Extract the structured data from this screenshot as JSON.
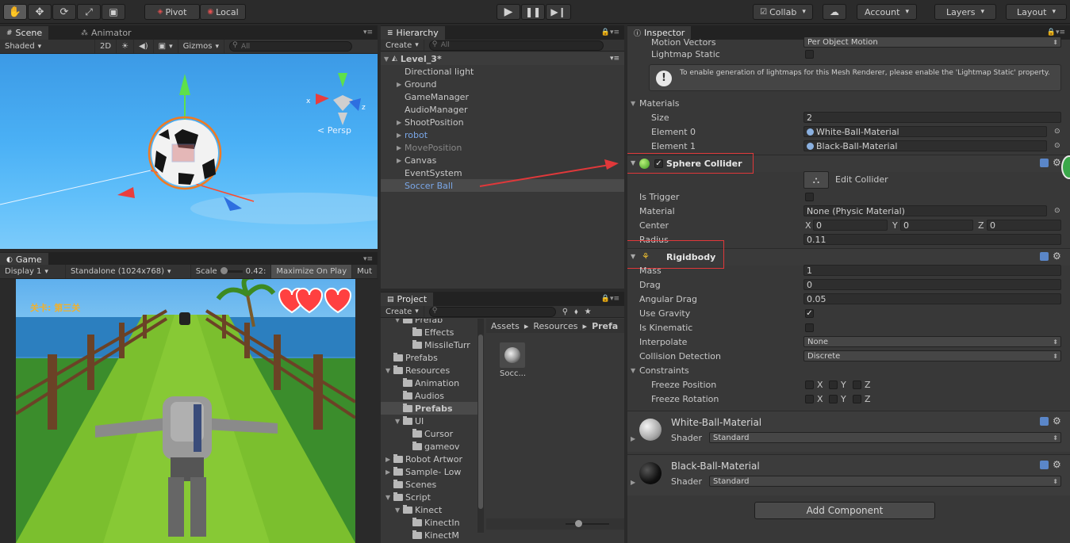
{
  "toolbar": {
    "tools": [
      "hand-tool-icon",
      "move-tool-icon",
      "rotate-tool-icon",
      "scale-tool-icon",
      "rect-tool-icon"
    ],
    "pivot_label": "Pivot",
    "local_label": "Local",
    "collab_label": "Collab",
    "account_label": "Account",
    "layers_label": "Layers",
    "layout_label": "Layout"
  },
  "scene": {
    "tab_label": "Scene",
    "animator_tab_label": "Animator",
    "shading_mode": "Shaded",
    "mode_2d": "2D",
    "gizmos_label": "Gizmos",
    "search_placeholder": "All",
    "persp_label": "< Persp",
    "axis_x": "x",
    "axis_z": "z"
  },
  "game": {
    "tab_label": "Game",
    "display": "Display 1",
    "resolution": "Standalone (1024x768)",
    "scale_label": "Scale",
    "scale_value": "0.42:",
    "maximize_label": "Maximize On Play",
    "mute_label": "Mut",
    "level_text": "关卡: 第三关"
  },
  "hierarchy": {
    "tab_label": "Hierarchy",
    "create_label": "Create",
    "search_placeholder": "All",
    "scene_name": "Level_3*",
    "items": [
      {
        "label": "Directional light",
        "arrow": "",
        "color": "#c8c8c8"
      },
      {
        "label": "Ground",
        "arrow": "▶",
        "color": "#c8c8c8"
      },
      {
        "label": "GameManager",
        "arrow": "",
        "color": "#c8c8c8"
      },
      {
        "label": "AudioManager",
        "arrow": "",
        "color": "#c8c8c8"
      },
      {
        "label": "ShootPosition",
        "arrow": "▶",
        "color": "#c8c8c8"
      },
      {
        "label": "robot",
        "arrow": "▶",
        "color": "#7aa7e8"
      },
      {
        "label": "MovePosition",
        "arrow": "▶",
        "color": "#888888"
      },
      {
        "label": "Canvas",
        "arrow": "▶",
        "color": "#c8c8c8"
      },
      {
        "label": "EventSystem",
        "arrow": "",
        "color": "#c8c8c8"
      },
      {
        "label": "Soccer Ball",
        "arrow": "",
        "color": "#7aa7e8"
      }
    ]
  },
  "project": {
    "tab_label": "Project",
    "create_label": "Create",
    "breadcrumb": [
      "Assets",
      "Resources",
      "Prefa"
    ],
    "asset_label": "Socc...",
    "tree": [
      {
        "label": "Prefab",
        "indent": 2,
        "arrow": "▼"
      },
      {
        "label": "Effects",
        "indent": 3,
        "arrow": ""
      },
      {
        "label": "MissileTurr",
        "indent": 3,
        "arrow": ""
      },
      {
        "label": "Prefabs",
        "indent": 1,
        "arrow": ""
      },
      {
        "label": "Resources",
        "indent": 1,
        "arrow": "▼"
      },
      {
        "label": "Animation",
        "indent": 2,
        "arrow": ""
      },
      {
        "label": "Audios",
        "indent": 2,
        "arrow": ""
      },
      {
        "label": "Prefabs",
        "indent": 2,
        "arrow": "",
        "selected": true
      },
      {
        "label": "UI",
        "indent": 2,
        "arrow": "▼"
      },
      {
        "label": "Cursor",
        "indent": 3,
        "arrow": ""
      },
      {
        "label": "gameov",
        "indent": 3,
        "arrow": ""
      },
      {
        "label": "Robot Artwor",
        "indent": 1,
        "arrow": "▶"
      },
      {
        "label": "Sample- Low",
        "indent": 1,
        "arrow": "▶"
      },
      {
        "label": "Scenes",
        "indent": 1,
        "arrow": ""
      },
      {
        "label": "Script",
        "indent": 1,
        "arrow": "▼"
      },
      {
        "label": "Kinect",
        "indent": 2,
        "arrow": "▼"
      },
      {
        "label": "KinectIn",
        "indent": 3,
        "arrow": ""
      },
      {
        "label": "KinectM",
        "indent": 3,
        "arrow": ""
      }
    ]
  },
  "inspector": {
    "tab_label": "Inspector",
    "motion_vectors_label": "Motion Vectors",
    "motion_vectors_value": "Per Object Motion",
    "lightmap_static_label": "Lightmap Static",
    "info_text": "To enable generation of lightmaps for this Mesh Renderer, please enable the 'Lightmap Static' property.",
    "materials_label": "Materials",
    "size_label": "Size",
    "size_value": "2",
    "element0_label": "Element 0",
    "element0_value": "White-Ball-Material",
    "element1_label": "Element 1",
    "element1_value": "Black-Ball-Material",
    "sphere_collider": {
      "title": "Sphere Collider",
      "edit_collider_label": "Edit Collider",
      "is_trigger_label": "Is Trigger",
      "material_label": "Material",
      "material_value": "None (Physic Material)",
      "center_label": "Center",
      "center_x": "0",
      "center_y": "0",
      "center_z": "0",
      "radius_label": "Radius",
      "radius_value": "0.11"
    },
    "rigidbody": {
      "title": "Rigidbody",
      "mass_label": "Mass",
      "mass_value": "1",
      "drag_label": "Drag",
      "drag_value": "0",
      "angular_drag_label": "Angular Drag",
      "angular_drag_value": "0.05",
      "use_gravity_label": "Use Gravity",
      "is_kinematic_label": "Is Kinematic",
      "interpolate_label": "Interpolate",
      "interpolate_value": "None",
      "collision_label": "Collision Detection",
      "collision_value": "Discrete",
      "constraints_label": "Constraints",
      "freeze_position_label": "Freeze Position",
      "freeze_rotation_label": "Freeze Rotation",
      "x": "X",
      "y": "Y",
      "z": "Z"
    },
    "materials_list": [
      {
        "name": "White-Ball-Material",
        "shader_label": "Shader",
        "shader_value": "Standard"
      },
      {
        "name": "Black-Ball-Material",
        "shader_label": "Shader",
        "shader_value": "Standard"
      }
    ],
    "add_component_label": "Add Component"
  },
  "colors": {
    "highlight_red": "#e0383a",
    "selection_blue": "#7aa7e8",
    "sky": "#48a8f0"
  }
}
